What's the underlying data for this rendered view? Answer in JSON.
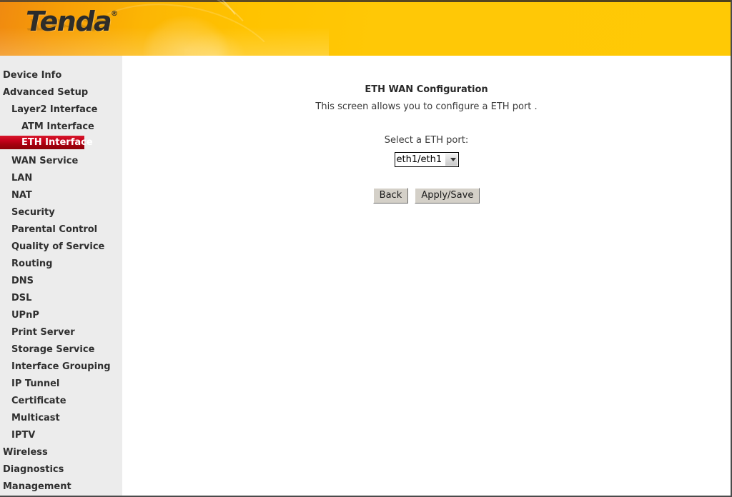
{
  "brand": {
    "logo_text": "Tenda",
    "logo_trademark": "®"
  },
  "sidebar": {
    "items": [
      {
        "label": "Device Info",
        "level": 0,
        "active": false
      },
      {
        "label": "Advanced Setup",
        "level": 0,
        "active": false
      },
      {
        "label": "Layer2 Interface",
        "level": 1,
        "active": false
      },
      {
        "label": "ATM Interface",
        "level": 2,
        "active": false
      },
      {
        "label": "ETH Interface",
        "level": 2,
        "active": true
      },
      {
        "label": "WAN Service",
        "level": 1,
        "active": false
      },
      {
        "label": "LAN",
        "level": 1,
        "active": false
      },
      {
        "label": "NAT",
        "level": 1,
        "active": false
      },
      {
        "label": "Security",
        "level": 1,
        "active": false
      },
      {
        "label": "Parental Control",
        "level": 1,
        "active": false
      },
      {
        "label": "Quality of Service",
        "level": 1,
        "active": false
      },
      {
        "label": "Routing",
        "level": 1,
        "active": false
      },
      {
        "label": "DNS",
        "level": 1,
        "active": false
      },
      {
        "label": "DSL",
        "level": 1,
        "active": false
      },
      {
        "label": "UPnP",
        "level": 1,
        "active": false
      },
      {
        "label": "Print Server",
        "level": 1,
        "active": false
      },
      {
        "label": "Storage Service",
        "level": 1,
        "active": false
      },
      {
        "label": "Interface Grouping",
        "level": 1,
        "active": false
      },
      {
        "label": "IP Tunnel",
        "level": 1,
        "active": false
      },
      {
        "label": "Certificate",
        "level": 1,
        "active": false
      },
      {
        "label": "Multicast",
        "level": 1,
        "active": false
      },
      {
        "label": "IPTV",
        "level": 1,
        "active": false
      },
      {
        "label": "Wireless",
        "level": 0,
        "active": false
      },
      {
        "label": "Diagnostics",
        "level": 0,
        "active": false
      },
      {
        "label": "Management",
        "level": 0,
        "active": false
      }
    ]
  },
  "main": {
    "title": "ETH WAN Configuration",
    "description": "This screen allows you to configure a ETH port .",
    "field_label": "Select a ETH port:",
    "eth_port": {
      "selected": "eth1/eth1",
      "options": [
        "eth1/eth1"
      ]
    },
    "buttons": {
      "back": "Back",
      "apply_save": "Apply/Save"
    }
  },
  "colors": {
    "banner_start": "#f08a10",
    "banner_end": "#ffc905",
    "sidebar_bg": "#ececec",
    "active_red": "#c4001a",
    "button_face": "#d4d0c8"
  }
}
